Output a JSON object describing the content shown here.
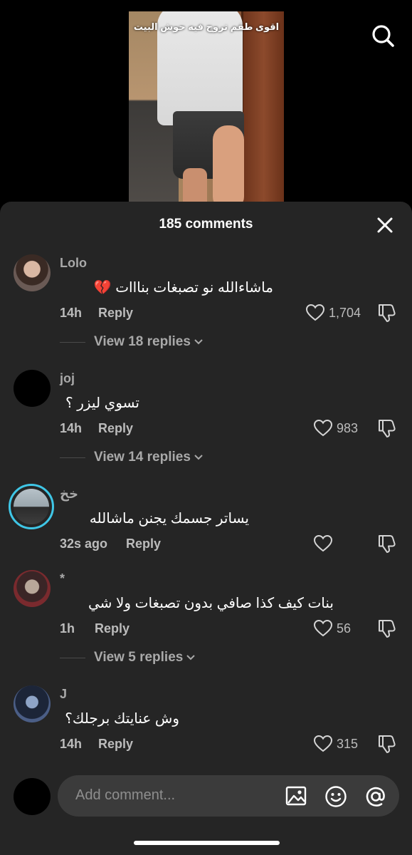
{
  "video": {
    "caption": "اقوى طقم تروح فيه حوش البيت"
  },
  "sheet": {
    "title": "185 comments"
  },
  "comments": [
    {
      "username": "Lolo",
      "text": "ماشاءالله نو تصبغات بنااات 💔",
      "time": "14h",
      "reply_label": "Reply",
      "likes": "1,704",
      "view_replies": "View 18 replies"
    },
    {
      "username": "joj",
      "text": "تسوي ليزر ؟",
      "time": "14h",
      "reply_label": "Reply",
      "likes": "983",
      "view_replies": "View 14 replies"
    },
    {
      "username": "خخ",
      "text": "يساتر جسمك يجنن ماشالله",
      "time": "32s ago",
      "reply_label": "Reply",
      "likes": ""
    },
    {
      "username": "*",
      "text": "بنات كيف كذا صافي بدون تصبغات ولا شي",
      "time": "1h",
      "reply_label": "Reply",
      "likes": "56",
      "view_replies": "View 5 replies"
    },
    {
      "username": "J",
      "text": "وش عنايتك برجلك؟",
      "time": "14h",
      "reply_label": "Reply",
      "likes": "315"
    }
  ],
  "composer": {
    "placeholder": "Add comment..."
  },
  "icons": {
    "search": "search-icon",
    "close": "close-icon",
    "heart": "heart-icon",
    "dislike": "dislike-icon",
    "image": "image-icon",
    "emoji": "emoji-icon",
    "mention": "at-icon"
  },
  "colors": {
    "sheet_bg": "#252525",
    "input_bg": "#3b3b3b",
    "story_ring": "#3fc6e6"
  }
}
